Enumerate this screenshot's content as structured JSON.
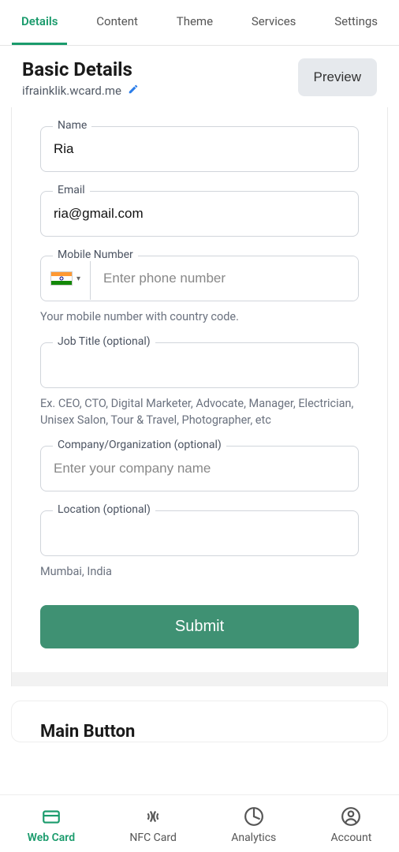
{
  "tabs": {
    "details": "Details",
    "content": "Content",
    "theme": "Theme",
    "services": "Services",
    "settings": "Settings"
  },
  "header": {
    "title": "Basic Details",
    "subdomain": "ifrainklik.wcard.me",
    "preview": "Preview"
  },
  "fields": {
    "name": {
      "label": "Name",
      "value": "Ria"
    },
    "email": {
      "label": "Email",
      "value": "ria@gmail.com"
    },
    "mobile": {
      "label": "Mobile Number",
      "placeholder": "Enter phone number",
      "helper": "Your mobile number with country code."
    },
    "job": {
      "label": "Job Title (optional)",
      "helper": "Ex. CEO, CTO, Digital Marketer, Advocate, Manager, Electrician, Unisex Salon, Tour & Travel, Photographer, etc"
    },
    "company": {
      "label": "Company/Organization (optional)",
      "placeholder": "Enter your company name"
    },
    "location": {
      "label": "Location (optional)",
      "helper": "Mumbai, India"
    }
  },
  "submit": "Submit",
  "section2": {
    "title": "Main Button"
  },
  "nav": {
    "webcard": "Web Card",
    "nfccard": "NFC Card",
    "analytics": "Analytics",
    "account": "Account"
  }
}
